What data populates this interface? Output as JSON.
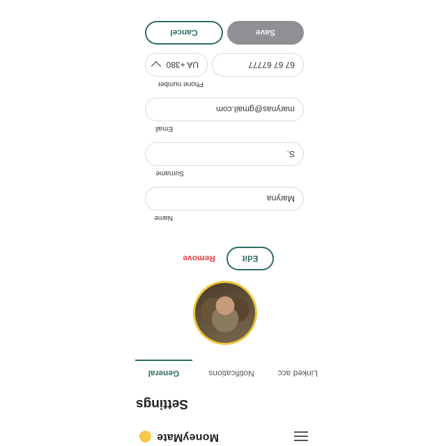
{
  "header": {
    "brand": "MoneyMate",
    "logo_icon": "coin-icon",
    "menu_icon": "hamburger-menu-icon",
    "logo_color": "#f3c84b"
  },
  "page_title": "Settings",
  "tabs": [
    {
      "label": "General",
      "active": true
    },
    {
      "label": "Notifications",
      "active": false
    },
    {
      "label": "Linked acc",
      "active": false
    }
  ],
  "profile": {
    "avatar_icon": "profile-photo",
    "edit_label": "Edit",
    "remove_label": "Remove"
  },
  "form": {
    "name": {
      "label": "Name",
      "value": "Maryna"
    },
    "surname": {
      "label": "Surname",
      "value": "S."
    },
    "email": {
      "label": "Email",
      "value": "marynas@gmail.com"
    },
    "phone": {
      "label": "Phone number",
      "country_code": "UA +380",
      "number": "67 67 67777"
    }
  },
  "actions": {
    "save_label": "Save",
    "cancel_label": "Cancel"
  },
  "colors": {
    "accent": "#2e6b64",
    "danger": "#e23d3d",
    "disabled_button": "#8e9093",
    "avatar_border": "#f0c43a"
  }
}
